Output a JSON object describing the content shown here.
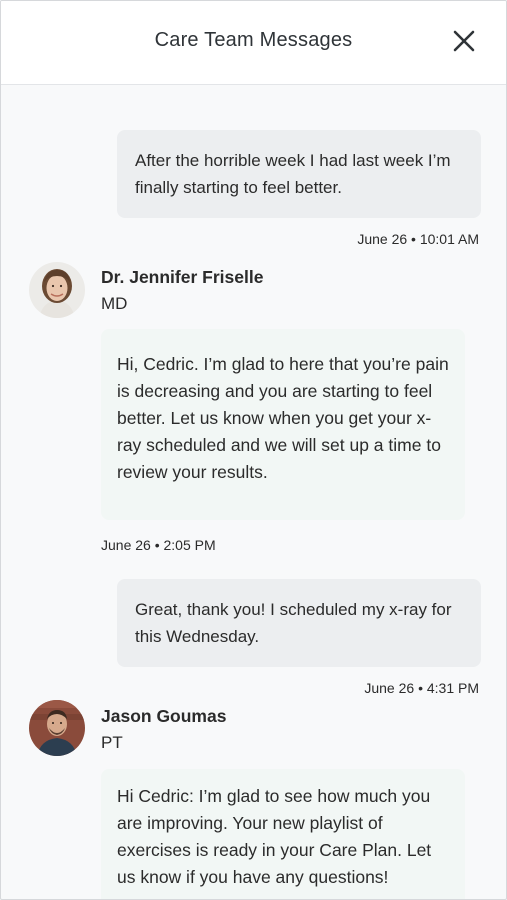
{
  "header": {
    "title": "Care Team Messages",
    "close_icon": "close-icon"
  },
  "messages": [
    {
      "type": "sent",
      "text": "After the horrible week I had last week I’m finally starting to feel better.",
      "timestamp": "June 26 • 10:01 AM"
    },
    {
      "type": "received",
      "sender": "Dr. Jennifer Friselle",
      "role": "MD",
      "text": "Hi, Cedric. I’m glad to here that you’re pain is decreasing and you are starting to feel better. Let us know when you get your x-ray scheduled and we will set up a time to review your results.",
      "timestamp": "June 26 • 2:05 PM"
    },
    {
      "type": "sent",
      "text": "Great, thank you! I scheduled my x-ray for this Wednesday.",
      "timestamp": "June 26 • 4:31 PM"
    },
    {
      "type": "received",
      "sender": "Jason Goumas",
      "role": "PT",
      "text": "Hi Cedric: I’m glad to see how much you are improving. Your new playlist of exercises is ready in your Care Plan. Let us know if you have any questions!"
    }
  ]
}
